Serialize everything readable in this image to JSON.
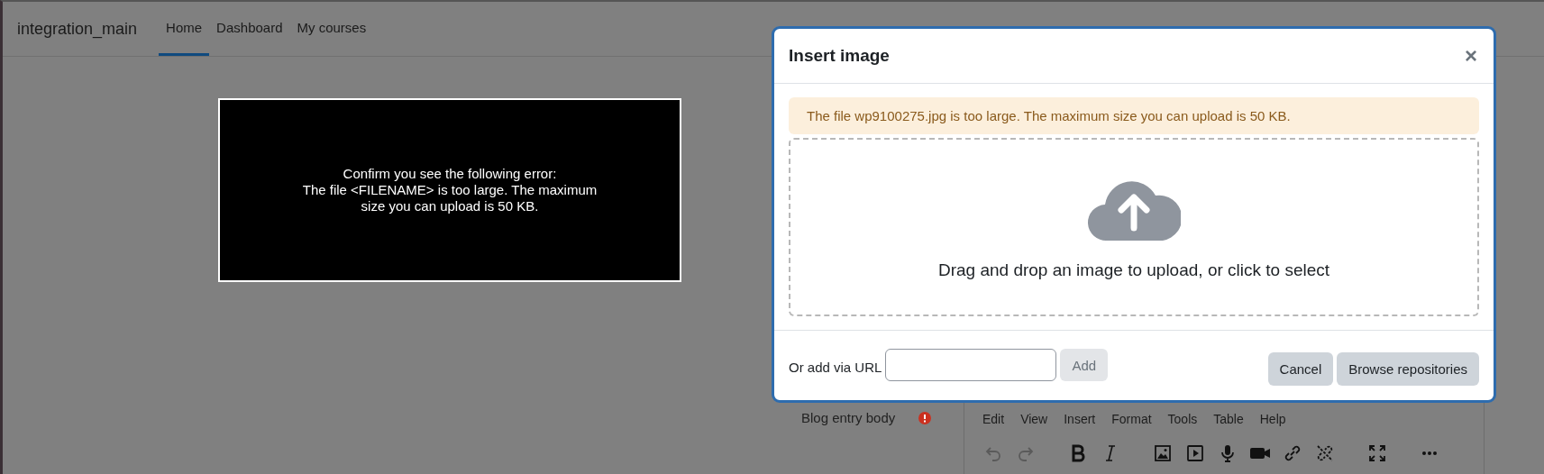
{
  "site_name": "integration_main",
  "nav": [
    {
      "label": "Home",
      "selected": true
    },
    {
      "label": "Dashboard",
      "selected": false
    },
    {
      "label": "My courses",
      "selected": false
    }
  ],
  "notice": {
    "lines": [
      "Confirm you see the following error:",
      "The file <FILENAME> is too large. The maximum size you can upload is 50 KB."
    ]
  },
  "form": {
    "field_label": "Blog entry body",
    "required": true,
    "editor_menu": [
      "Edit",
      "View",
      "Insert",
      "Format",
      "Tools",
      "Table",
      "Help"
    ],
    "toolbar": [
      {
        "kind": "undo",
        "disabled": true
      },
      {
        "kind": "redo",
        "disabled": true
      },
      {
        "kind": "bold",
        "disabled": false
      },
      {
        "kind": "italic",
        "disabled": false
      },
      {
        "kind": "image",
        "disabled": false
      },
      {
        "kind": "media",
        "disabled": false
      },
      {
        "kind": "mic",
        "disabled": false
      },
      {
        "kind": "camera",
        "disabled": false
      },
      {
        "kind": "link",
        "disabled": false
      },
      {
        "kind": "unlink",
        "disabled": false
      },
      {
        "kind": "fullscreen",
        "disabled": false
      },
      {
        "kind": "more",
        "disabled": false
      }
    ]
  },
  "dialog": {
    "title": "Insert image",
    "close": "×",
    "alert": "The file wp9100275.jpg is too large. The maximum size you can upload is 50 KB.",
    "dropzone_text": "Drag and drop an image to upload, or click to select",
    "url_label": "Or add via URL",
    "add_button": {
      "label": "Add",
      "disabled": true
    },
    "buttons": [
      "Cancel",
      "Browse repositories"
    ]
  }
}
